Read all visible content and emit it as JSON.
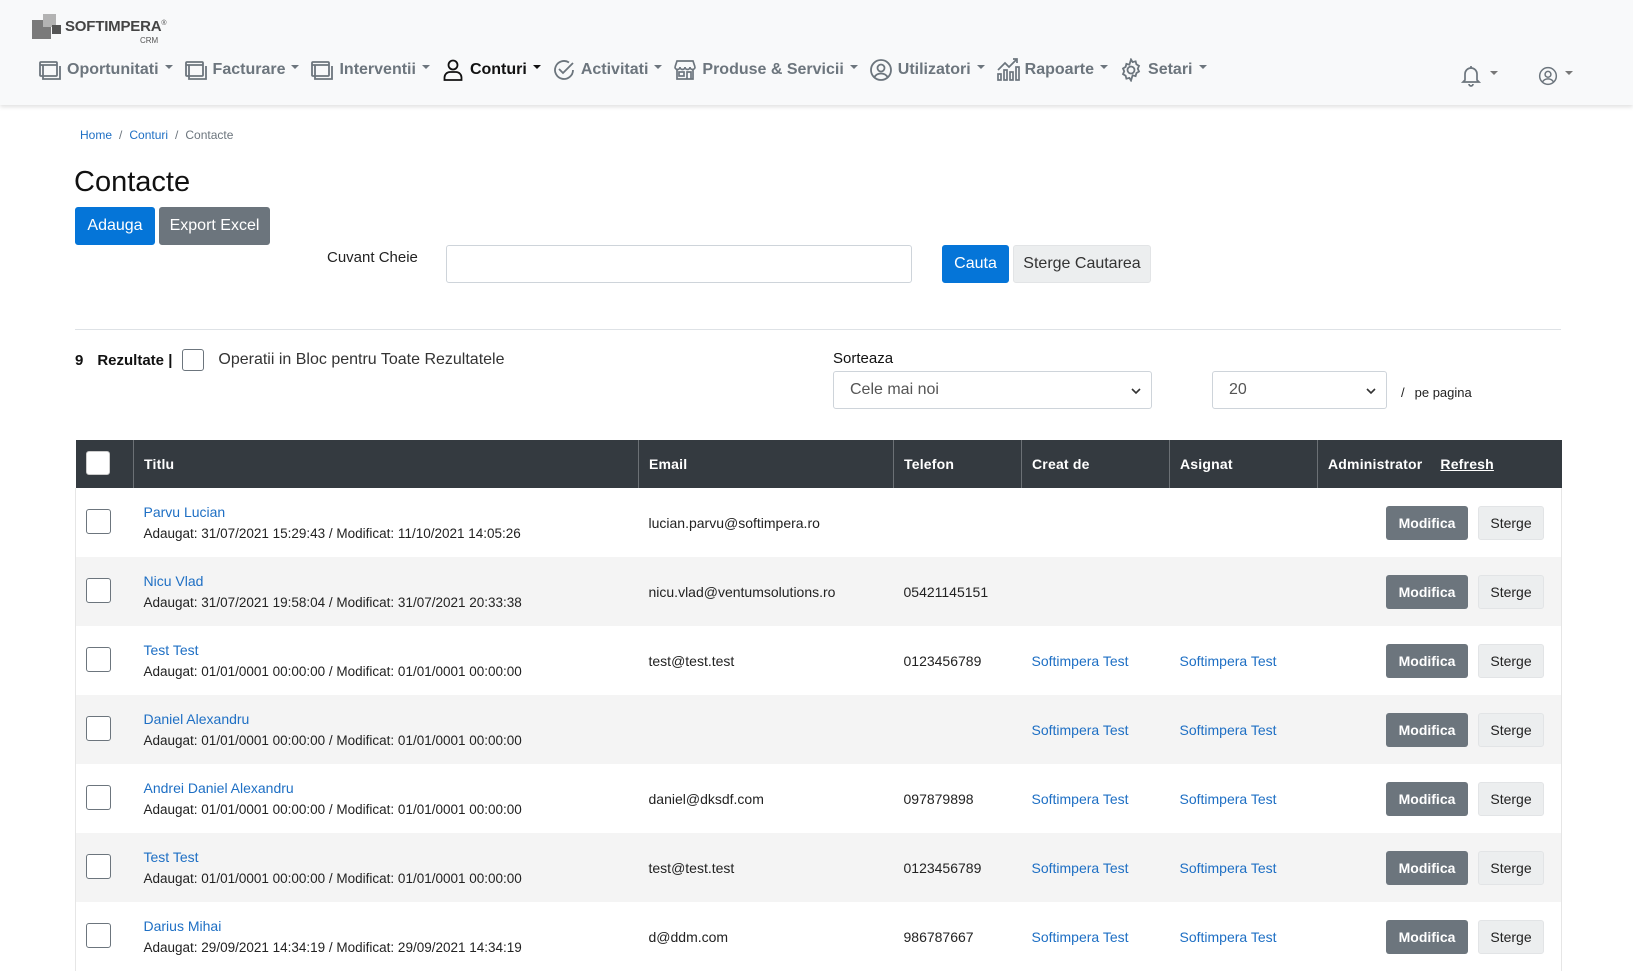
{
  "logo": {
    "brand": "SOFTIMPERA",
    "reg": "®",
    "sub": "CRM"
  },
  "nav": [
    {
      "label": "Oportunitati",
      "icon": "window-icon",
      "active": false
    },
    {
      "label": "Facturare",
      "icon": "window-icon",
      "active": false
    },
    {
      "label": "Interventii",
      "icon": "window-icon",
      "active": false
    },
    {
      "label": "Conturi",
      "icon": "user-icon",
      "active": true
    },
    {
      "label": "Activitati",
      "icon": "check-circle-icon",
      "active": false
    },
    {
      "label": "Produse & Servicii",
      "icon": "shop-icon",
      "active": false
    },
    {
      "label": "Utilizatori",
      "icon": "user-circle-icon",
      "active": false
    },
    {
      "label": "Rapoarte",
      "icon": "graph-up-icon",
      "active": false
    },
    {
      "label": "Setari",
      "icon": "gear-icon",
      "active": false
    }
  ],
  "breadcrumb": {
    "home": "Home",
    "accounts": "Conturi",
    "current": "Contacte",
    "separator": "/"
  },
  "page": {
    "title": "Contacte"
  },
  "toolbar": {
    "add_label": "Adauga",
    "export_label": "Export Excel"
  },
  "search": {
    "label": "Cuvant Cheie",
    "value": "",
    "placeholder": "",
    "search_label": "Cauta",
    "clear_label": "Sterge Cautarea"
  },
  "results": {
    "count": "9",
    "label": "Rezultate |",
    "bulk_label": "Operatii in Bloc pentru Toate Rezultatele"
  },
  "sort": {
    "label": "Sorteaza",
    "selected": "Cele mai noi"
  },
  "pagination": {
    "per_page_value": "20",
    "slash": "/",
    "per_page_label": "pe pagina"
  },
  "table": {
    "headers": {
      "title": "Titlu",
      "email": "Email",
      "phone": "Telefon",
      "created_by": "Creat de",
      "assigned": "Asignat",
      "admin": "Administrator",
      "refresh": "Refresh"
    },
    "edit_label": "Modifica",
    "delete_label": "Sterge",
    "rows": [
      {
        "name": "Parvu Lucian",
        "meta": "Adaugat: 31/07/2021 15:29:43 / Modificat: 11/10/2021 14:05:26",
        "email": "lucian.parvu@softimpera.ro",
        "phone": "",
        "created_by": "",
        "assigned": ""
      },
      {
        "name": "Nicu Vlad",
        "meta": "Adaugat: 31/07/2021 19:58:04 / Modificat: 31/07/2021 20:33:38",
        "email": "nicu.vlad@ventumsolutions.ro",
        "phone": "05421145151",
        "created_by": "",
        "assigned": ""
      },
      {
        "name": "Test Test",
        "meta": "Adaugat: 01/01/0001 00:00:00 / Modificat: 01/01/0001 00:00:00",
        "email": "test@test.test",
        "phone": "0123456789",
        "created_by": "Softimpera Test",
        "assigned": "Softimpera Test"
      },
      {
        "name": "Daniel Alexandru",
        "meta": "Adaugat: 01/01/0001 00:00:00 / Modificat: 01/01/0001 00:00:00",
        "email": "",
        "phone": "",
        "created_by": "Softimpera Test",
        "assigned": "Softimpera Test"
      },
      {
        "name": "Andrei Daniel Alexandru",
        "meta": "Adaugat: 01/01/0001 00:00:00 / Modificat: 01/01/0001 00:00:00",
        "email": "daniel@dksdf.com",
        "phone": "097879898",
        "created_by": "Softimpera Test",
        "assigned": "Softimpera Test"
      },
      {
        "name": "Test Test",
        "meta": "Adaugat: 01/01/0001 00:00:00 / Modificat: 01/01/0001 00:00:00",
        "email": "test@test.test",
        "phone": "0123456789",
        "created_by": "Softimpera Test",
        "assigned": "Softimpera Test"
      },
      {
        "name": "Darius Mihai",
        "meta": "Adaugat: 29/09/2021 14:34:19 / Modificat: 29/09/2021 14:34:19",
        "email": "d@ddm.com",
        "phone": "986787667",
        "created_by": "Softimpera Test",
        "assigned": "Softimpera Test"
      }
    ]
  },
  "colors": {
    "primary": "#0575d8",
    "secondary": "#6c757d",
    "header_bg": "#343a40",
    "link": "#1e6fc4",
    "navbar_bg": "#f8f9fa"
  },
  "icons": {
    "notifications": "bell-icon",
    "account": "user-circle-icon"
  }
}
